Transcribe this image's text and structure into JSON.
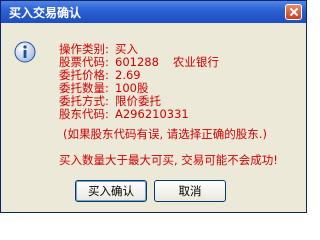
{
  "window": {
    "title": "买入交易确认"
  },
  "details": [
    {
      "label": "操作类别:",
      "value": "买入",
      "extra": ""
    },
    {
      "label": "股票代码:",
      "value": "601288",
      "extra": "农业银行"
    },
    {
      "label": "委托价格:",
      "value": "2.69",
      "extra": ""
    },
    {
      "label": "委托数量:",
      "value": "100股",
      "extra": ""
    },
    {
      "label": "委托方式:",
      "value": "限价委托",
      "extra": ""
    },
    {
      "label": "股东代码:",
      "value": "A296210331",
      "extra": ""
    }
  ],
  "note": "(如果股东代码有误, 请选择正确的股东.)",
  "warning": "买入数量大于最大可买, 交易可能不会成功!",
  "buttons": {
    "confirm": "买入确认",
    "cancel": "取消"
  },
  "icon": "info-icon"
}
